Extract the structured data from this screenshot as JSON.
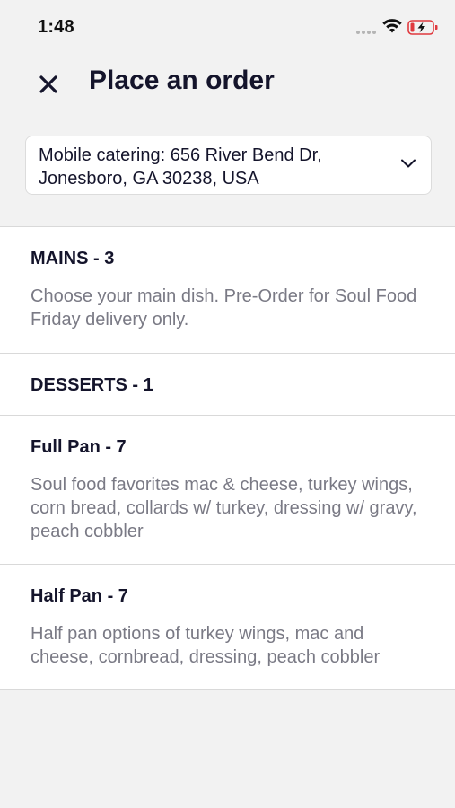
{
  "status_bar": {
    "time": "1:48"
  },
  "header": {
    "close_icon": "close-icon",
    "title": "Place an order"
  },
  "location": {
    "value": "Mobile catering: 656 River Bend Dr, Jonesboro, GA 30238, USA",
    "chevron_icon": "chevron-down-icon"
  },
  "categories": [
    {
      "title": "MAINS - 3",
      "description": "Choose your main dish. Pre-Order for Soul Food Friday delivery only."
    },
    {
      "title": "DESSERTS - 1",
      "description": ""
    },
    {
      "title": "Full Pan - 7",
      "description": "Soul food favorites mac & cheese, turkey wings, corn bread, collards w/ turkey, dressing w/ gravy, peach cobbler"
    },
    {
      "title": "Half Pan - 7",
      "description": "Half pan options of turkey wings, mac and cheese, cornbread, dressing, peach cobbler"
    }
  ],
  "colors": {
    "background": "#f2f2f2",
    "card": "#ffffff",
    "title_text": "#14142b",
    "description_text": "#7a7a85",
    "battery_low": "#e0393e"
  }
}
